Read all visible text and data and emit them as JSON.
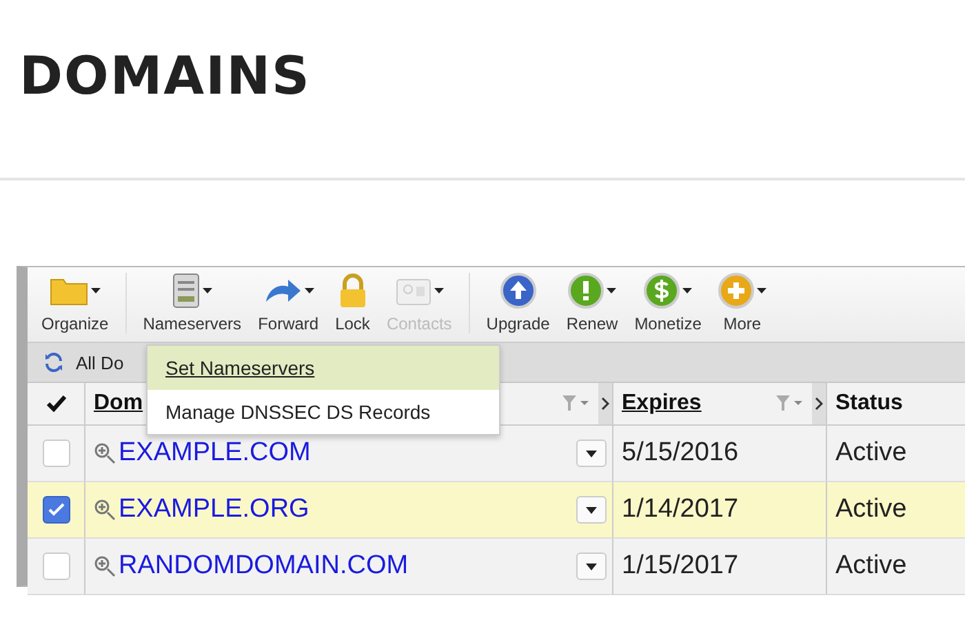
{
  "page_title": "DOMAINS",
  "toolbar": [
    {
      "label": "Organize",
      "has_menu": true,
      "disabled": false,
      "separator_after": true
    },
    {
      "label": "Nameservers",
      "has_menu": true,
      "disabled": false,
      "separator_after": false
    },
    {
      "label": "Forward",
      "has_menu": true,
      "disabled": false,
      "separator_after": false
    },
    {
      "label": "Lock",
      "has_menu": false,
      "disabled": false,
      "separator_after": false
    },
    {
      "label": "Contacts",
      "has_menu": true,
      "disabled": true,
      "separator_after": true
    },
    {
      "label": "Upgrade",
      "has_menu": false,
      "disabled": false,
      "separator_after": false
    },
    {
      "label": "Renew",
      "has_menu": true,
      "disabled": false,
      "separator_after": false
    },
    {
      "label": "Monetize",
      "has_menu": true,
      "disabled": false,
      "separator_after": false
    },
    {
      "label": "More",
      "has_menu": true,
      "disabled": false,
      "separator_after": false
    }
  ],
  "filter_bar": {
    "label": "All Do"
  },
  "columns": [
    {
      "label": "Dom",
      "sortable": true
    },
    {
      "label": "Expires",
      "sortable": true
    },
    {
      "label": "Status",
      "sortable": false
    }
  ],
  "rows": [
    {
      "checked": false,
      "domain": "EXAMPLE.COM",
      "expires": "5/15/2016",
      "status": "Active"
    },
    {
      "checked": true,
      "domain": "EXAMPLE.ORG",
      "expires": "1/14/2017",
      "status": "Active"
    },
    {
      "checked": false,
      "domain": "RANDOMDOMAIN.COM",
      "expires": "1/15/2017",
      "status": "Active"
    }
  ],
  "menu": [
    {
      "label": "Set Nameservers",
      "selected": true
    },
    {
      "label": "Manage DNSSEC DS Records",
      "selected": false
    }
  ]
}
